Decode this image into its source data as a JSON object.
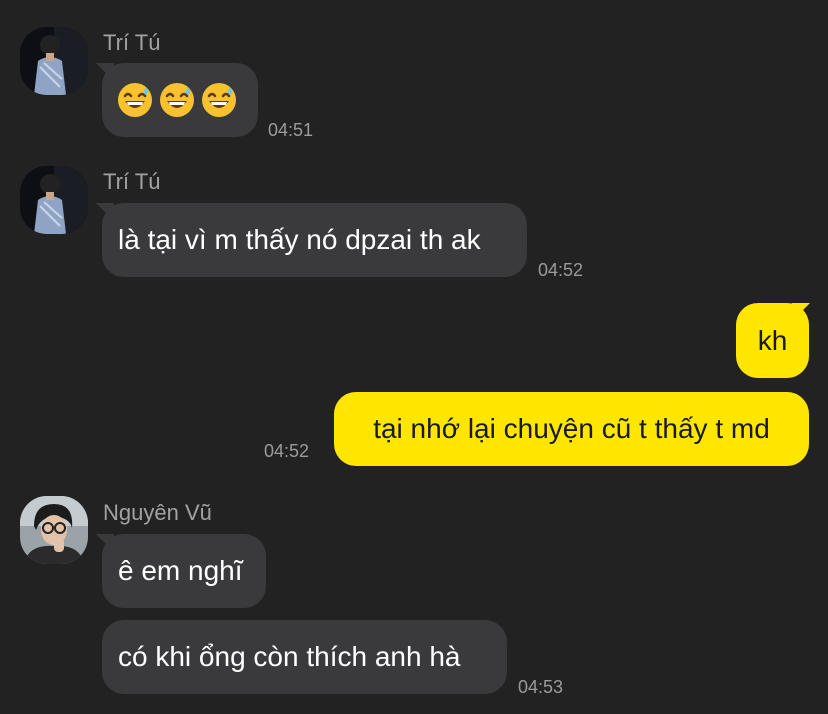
{
  "messages": [
    {
      "sender": "Trí Tú",
      "emojis": [
        "grinning-sweat-emoji",
        "grinning-sweat-emoji",
        "grinning-sweat-emoji"
      ],
      "time": "04:51"
    },
    {
      "sender": "Trí Tú",
      "text": "là tại vì m thấy nó dpzai th ak",
      "time": "04:52"
    },
    {
      "outgoing": true,
      "text": "kh"
    },
    {
      "outgoing": true,
      "text": "tại nhớ lại chuyện cũ t thấy t md",
      "time": "04:52"
    },
    {
      "sender": "Nguyên Vũ",
      "text": "ê em nghĩ"
    },
    {
      "text": "có khi ổng còn thích anh hà",
      "time": "04:53"
    }
  ],
  "colors": {
    "background": "#222222",
    "incoming_bubble": "#3a3a3c",
    "outgoing_bubble": "#ffe600"
  }
}
